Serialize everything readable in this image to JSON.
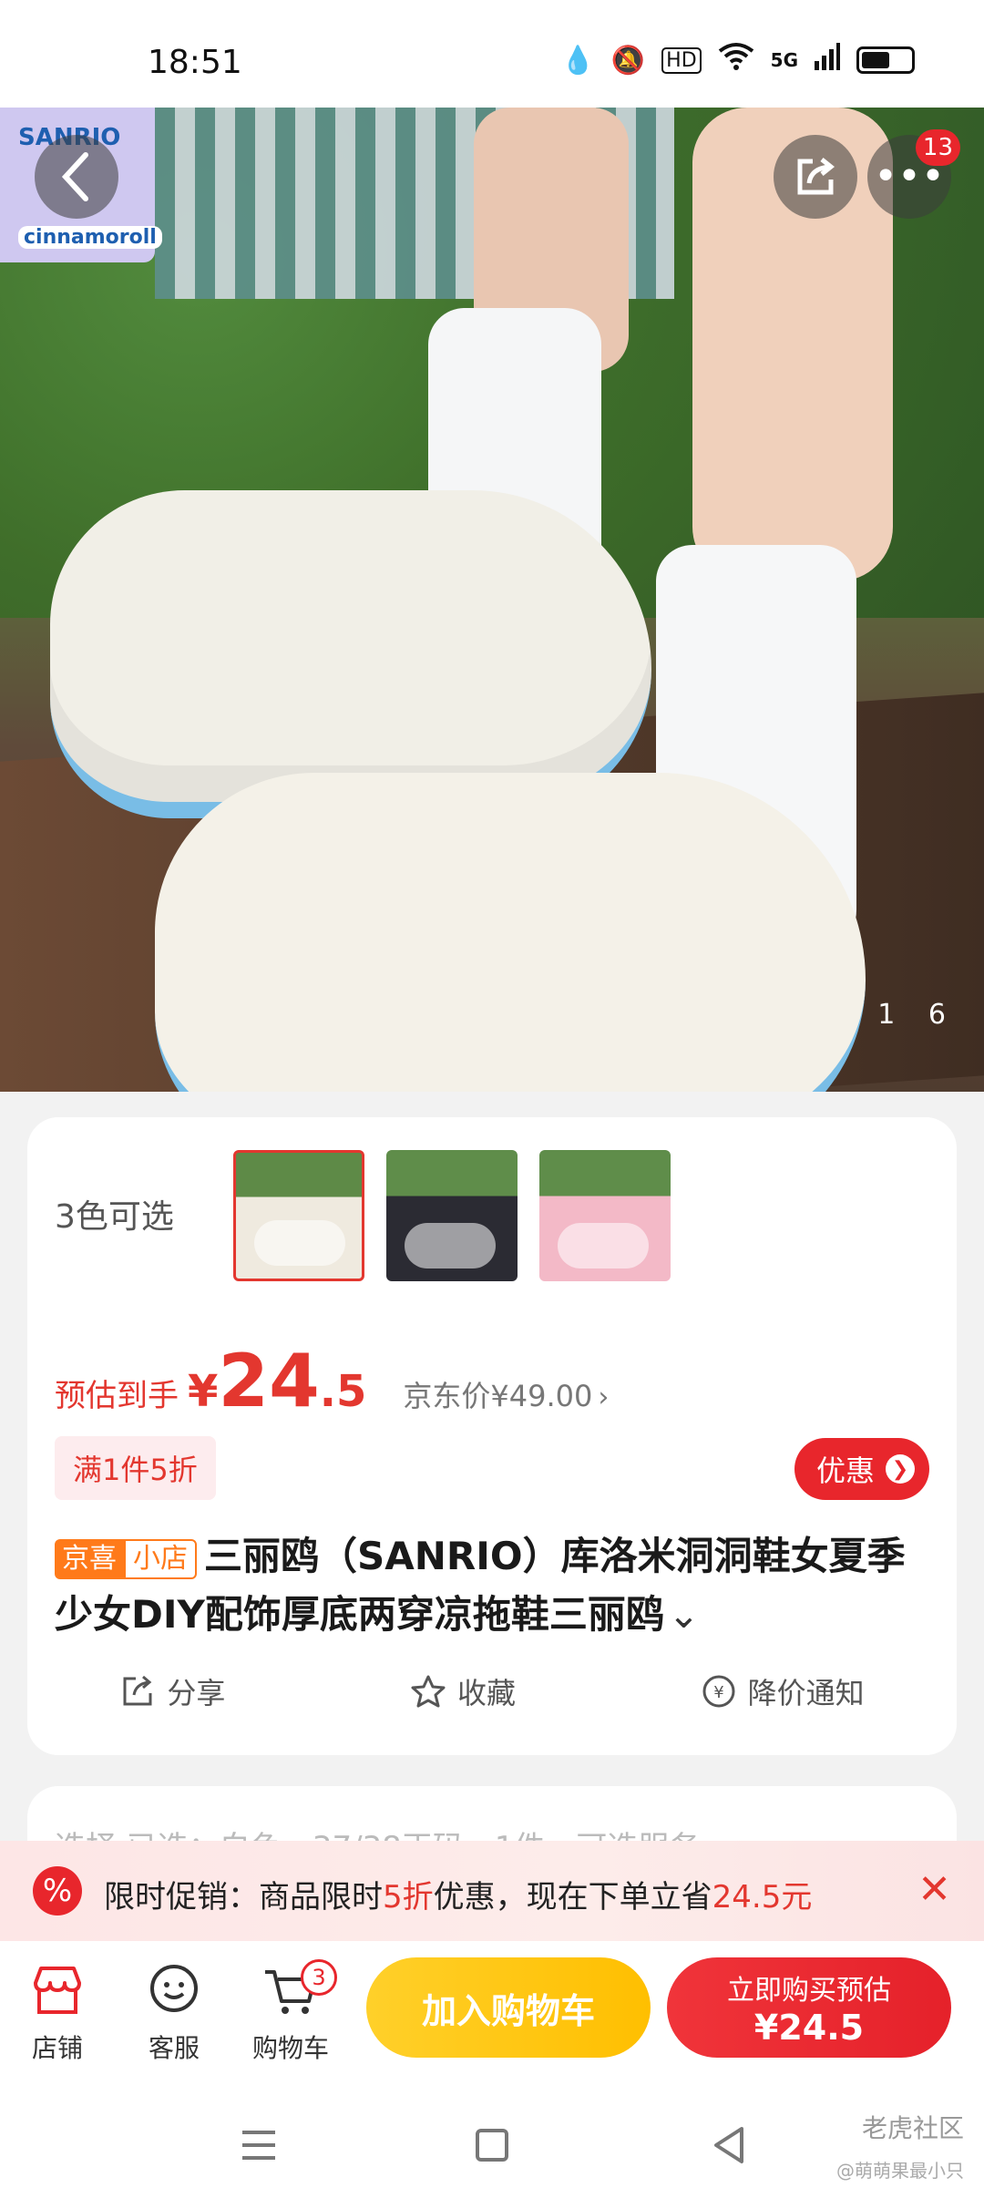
{
  "status_bar": {
    "time": "18:51",
    "icons": [
      "water-drop-icon",
      "bell-muted-icon",
      "hd-icon",
      "wifi-icon",
      "5g-signal-icon",
      "battery-icon"
    ],
    "hd": "HD",
    "network": "5G"
  },
  "hero": {
    "page_current": "1",
    "page_total": "6",
    "thumb_text_top": "SANRIO",
    "thumb_text_bottom": "cinnamoroll",
    "more_badge": "13"
  },
  "variants": {
    "label": "3色可选",
    "items": [
      {
        "name": "white",
        "selected": true
      },
      {
        "name": "black",
        "selected": false
      },
      {
        "name": "pink",
        "selected": false
      }
    ]
  },
  "price": {
    "label": "预估到手",
    "symbol": "¥",
    "integer": "24",
    "decimal": ".5",
    "jd_price": "京东价¥49.00",
    "jd_chevron": "›"
  },
  "promo": {
    "tag": "满1件5折",
    "discount_button": "优惠"
  },
  "title": {
    "tag_jx": "京喜",
    "tag_shop": "小店",
    "text": "三丽鸥（SANRIO）库洛米洞洞鞋女夏季少女DIY配饰厚底两穿凉拖鞋三丽鸥",
    "expand": "⌄"
  },
  "actions": {
    "share": "分享",
    "favorite": "收藏",
    "price_alert": "降价通知"
  },
  "select_row_ghost": "选择    已选：白色，37/38正码，1件，可选服务",
  "promo_banner": {
    "prefix": "限时促销：商品限时",
    "discount": "5折",
    "middle": "优惠，现在下单立省",
    "saving": "24.5元"
  },
  "bottom_bar": {
    "store": "店铺",
    "service": "客服",
    "cart": "购物车",
    "cart_count": "3",
    "add_to_cart": "加入购物车",
    "buy_line1": "立即购买预估",
    "buy_line2": "¥24.5"
  },
  "watermark": {
    "main": "老虎社区",
    "sub": "@萌萌果最小只"
  },
  "colors": {
    "accent_red": "#e8262c",
    "accent_yellow": "#ffbf00",
    "tag_orange": "#ff7a1a"
  }
}
